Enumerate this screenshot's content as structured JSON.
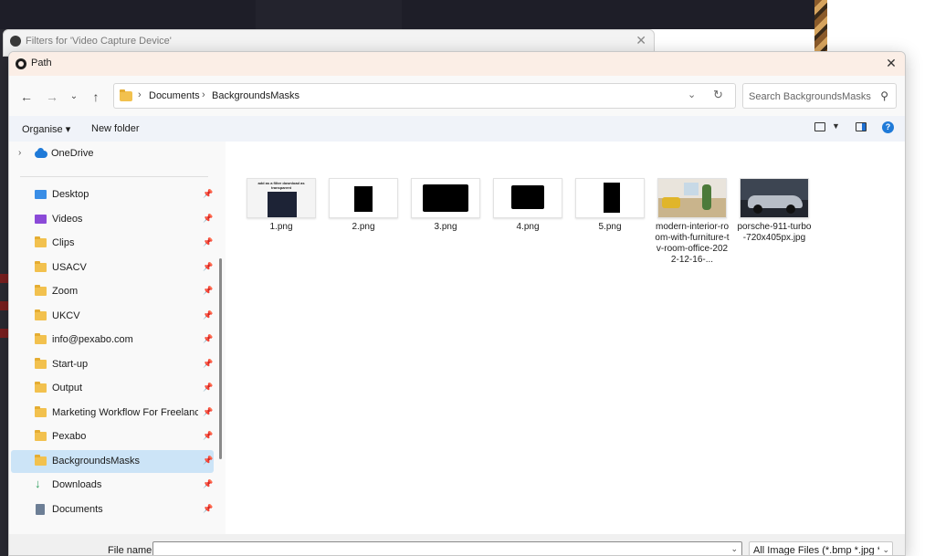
{
  "back_window": {
    "title": "Filters for 'Video Capture Device'"
  },
  "dialog": {
    "title": "Path",
    "address": {
      "crumbs": [
        "Documents",
        "BackgroundsMasks"
      ]
    },
    "search": {
      "placeholder": "Search BackgroundsMasks"
    },
    "commands": {
      "organise": "Organise ▾",
      "new_folder": "New folder"
    },
    "nav": {
      "onedrive": "OneDrive",
      "items": [
        {
          "label": "Desktop",
          "icon": "desktop-icon"
        },
        {
          "label": "Videos",
          "icon": "videos-icon"
        },
        {
          "label": "Clips",
          "icon": "folder-icon"
        },
        {
          "label": "USACV",
          "icon": "folder-icon"
        },
        {
          "label": "Zoom",
          "icon": "folder-icon"
        },
        {
          "label": "UKCV",
          "icon": "folder-icon"
        },
        {
          "label": "info@pexabo.com",
          "icon": "folder-icon"
        },
        {
          "label": "Start-up",
          "icon": "folder-icon"
        },
        {
          "label": "Output",
          "icon": "folder-icon"
        },
        {
          "label": "Marketing Workflow For Freelancers (",
          "icon": "folder-icon"
        },
        {
          "label": "Pexabo",
          "icon": "folder-icon"
        },
        {
          "label": "BackgroundsMasks",
          "icon": "folder-icon",
          "selected": true
        },
        {
          "label": "Downloads",
          "icon": "downloads-icon"
        },
        {
          "label": "Documents",
          "icon": "documents-icon"
        }
      ]
    },
    "files": [
      {
        "name": "1.png",
        "thumb_text": "add as a filter download as transparent"
      },
      {
        "name": "2.png"
      },
      {
        "name": "3.png"
      },
      {
        "name": "4.png"
      },
      {
        "name": "5.png"
      },
      {
        "name": "modern-interior-room-with-furniture-tv-room-office-2022-12-16-..."
      },
      {
        "name": "porsche-911-turbo-720x405px.jpg"
      }
    ],
    "footer": {
      "file_name_label": "File name:",
      "file_name_value": "",
      "filter": "All Image Files (*.bmp *.jpg *.jp"
    }
  }
}
